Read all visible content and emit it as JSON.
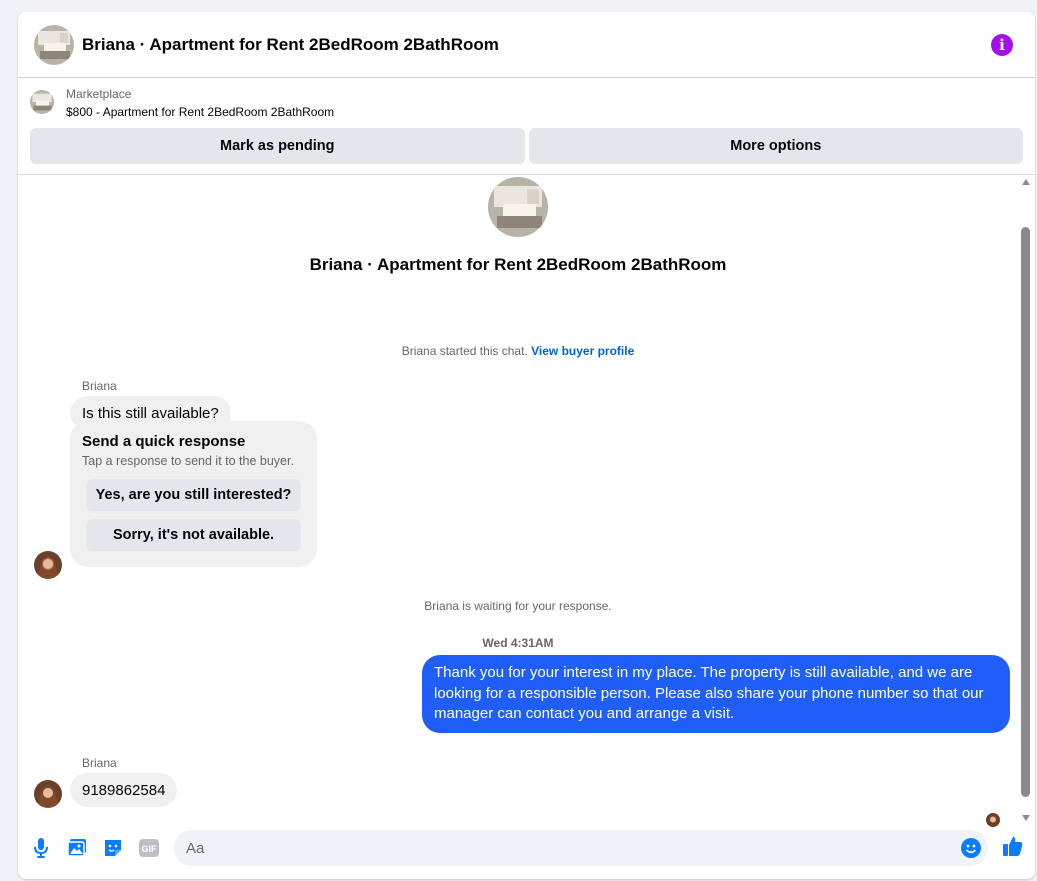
{
  "header": {
    "title": "Briana · Apartment for Rent 2BedRoom 2BathRoom",
    "info_icon": "info-icon"
  },
  "listing": {
    "source": "Marketplace",
    "title": "$800 - Apartment for Rent 2BedRoom 2BathRoom"
  },
  "actions": {
    "mark_pending": "Mark as pending",
    "more_options": "More options"
  },
  "conversation": {
    "hero_title": "Briana · Apartment for Rent 2BedRoom 2BathRoom",
    "started_text": "Briana started this chat.",
    "view_profile": "View buyer profile",
    "sender_name": "Briana",
    "first_message": "Is this still available?",
    "quick_response": {
      "title": "Send a quick response",
      "subtitle": "Tap a response to send it to the buyer.",
      "options": [
        "Yes, are you still interested?",
        "Sorry, it's not available."
      ]
    },
    "waiting_text": "Briana is waiting for your response.",
    "timestamp": "Wed 4:31AM",
    "my_reply": "Thank you for your interest in my place. The property is still available, and we are looking for a responsible person. Please also share your phone number so that our manager can contact you and arrange a visit.",
    "second_sender": "Briana",
    "second_message": "9189862584"
  },
  "composer": {
    "placeholder": "Aa",
    "icons": [
      "microphone-icon",
      "photo-icon",
      "sticker-icon",
      "gif-icon",
      "emoji-icon",
      "thumbs-up-icon"
    ],
    "gif_label": "GIF"
  },
  "colors": {
    "accent": "#1f5ff8",
    "info": "#a20fe8",
    "icon_blue": "#0a7cff"
  }
}
